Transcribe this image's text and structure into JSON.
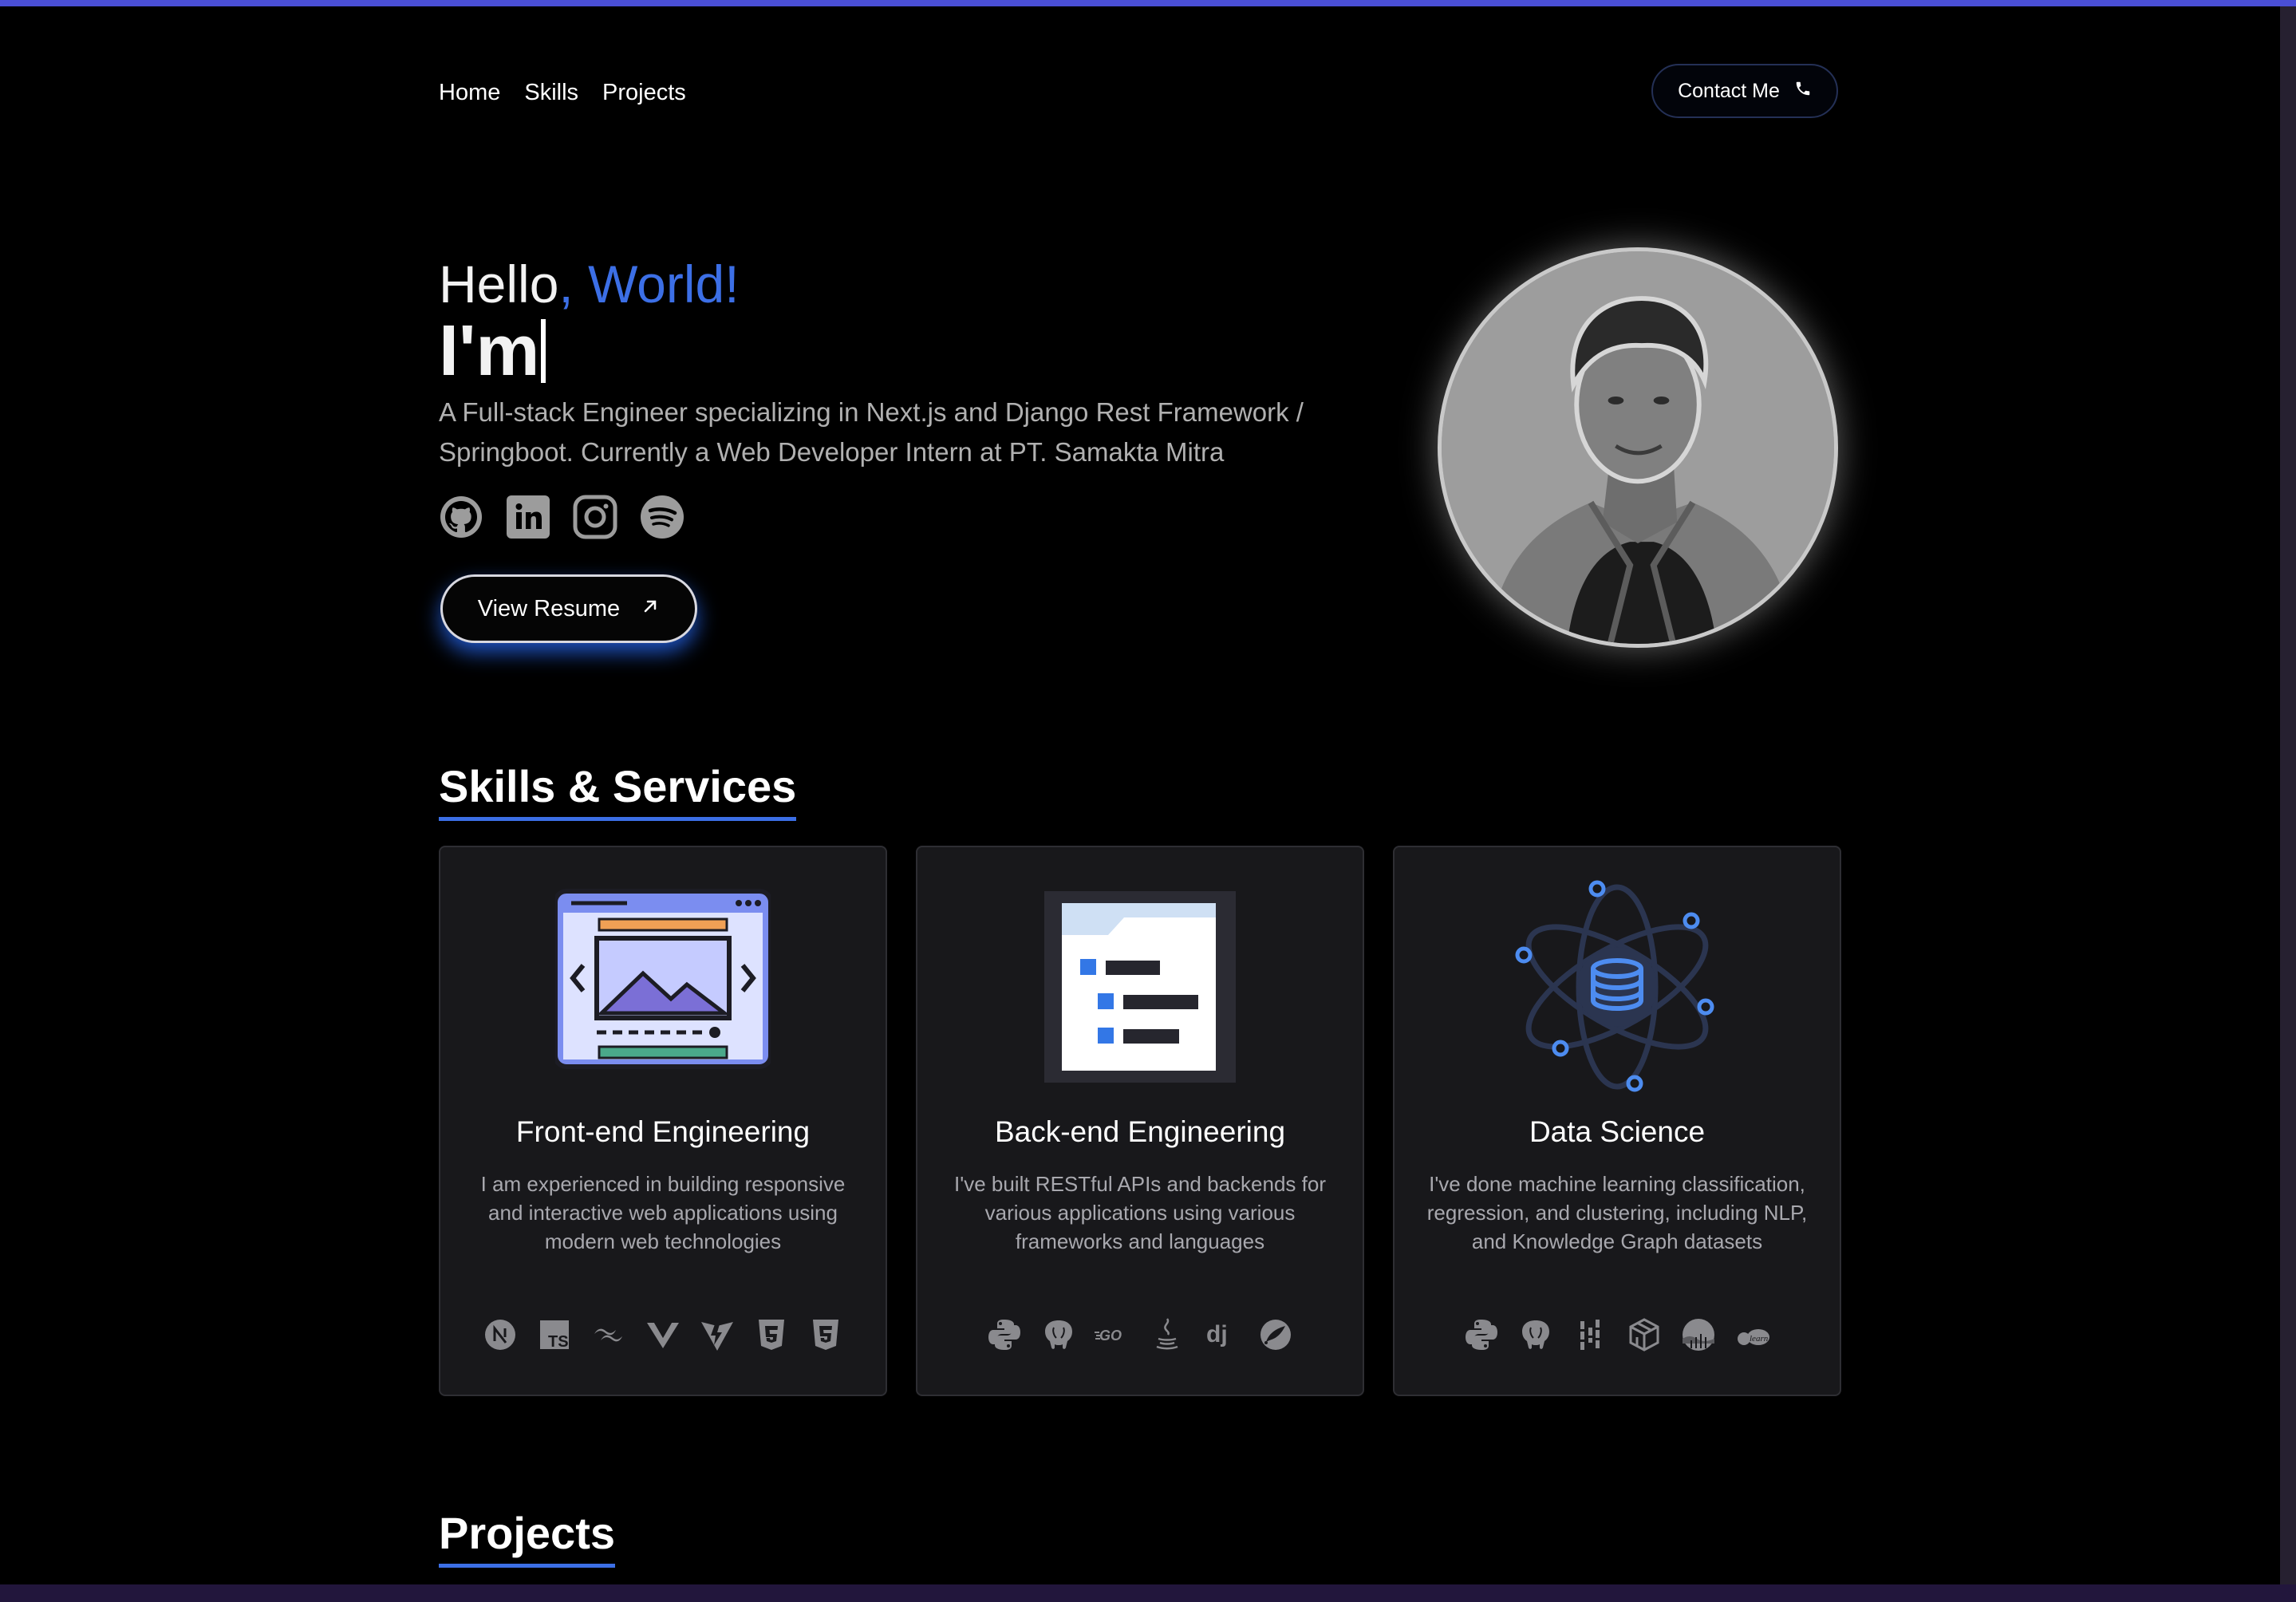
{
  "nav": {
    "links": [
      "Home",
      "Skills",
      "Projects"
    ],
    "contact_label": "Contact Me",
    "contact_icon": "phone-icon"
  },
  "hero": {
    "hello": "Hello",
    "world": ", World!",
    "im": "I'm",
    "tagline": "A Full-stack Engineer specializing in Next.js and Django Rest Framework / Springboot. Currently a Web Developer Intern at PT. Samakta Mitra",
    "socials": [
      "github-icon",
      "linkedin-icon",
      "instagram-icon",
      "spotify-icon"
    ],
    "resume_label": "View Resume",
    "accent_color": "#3c6fe6"
  },
  "skills": {
    "title": "Skills & Services",
    "cards": [
      {
        "title": "Front-end Engineering",
        "description": "I am experienced in building responsive and interactive web applications using modern web technologies",
        "tech_icons": [
          "nextjs-icon",
          "typescript-icon",
          "tailwind-icon",
          "vue-icon",
          "vite-icon",
          "html5-icon",
          "css3-icon"
        ]
      },
      {
        "title": "Back-end Engineering",
        "description": "I've built RESTful APIs and backends for various applications using various frameworks and languages",
        "tech_icons": [
          "python-icon",
          "postgresql-icon",
          "go-icon",
          "java-icon",
          "django-icon",
          "spring-icon"
        ]
      },
      {
        "title": "Data Science",
        "description": "I've done machine learning classification, regression, and clustering, including NLP, and Knowledge Graph datasets",
        "tech_icons": [
          "python-icon",
          "postgresql-icon",
          "pandas-icon",
          "numpy-icon",
          "seaborn-icon",
          "tensorflow-icon"
        ]
      }
    ]
  },
  "projects": {
    "title": "Projects"
  }
}
